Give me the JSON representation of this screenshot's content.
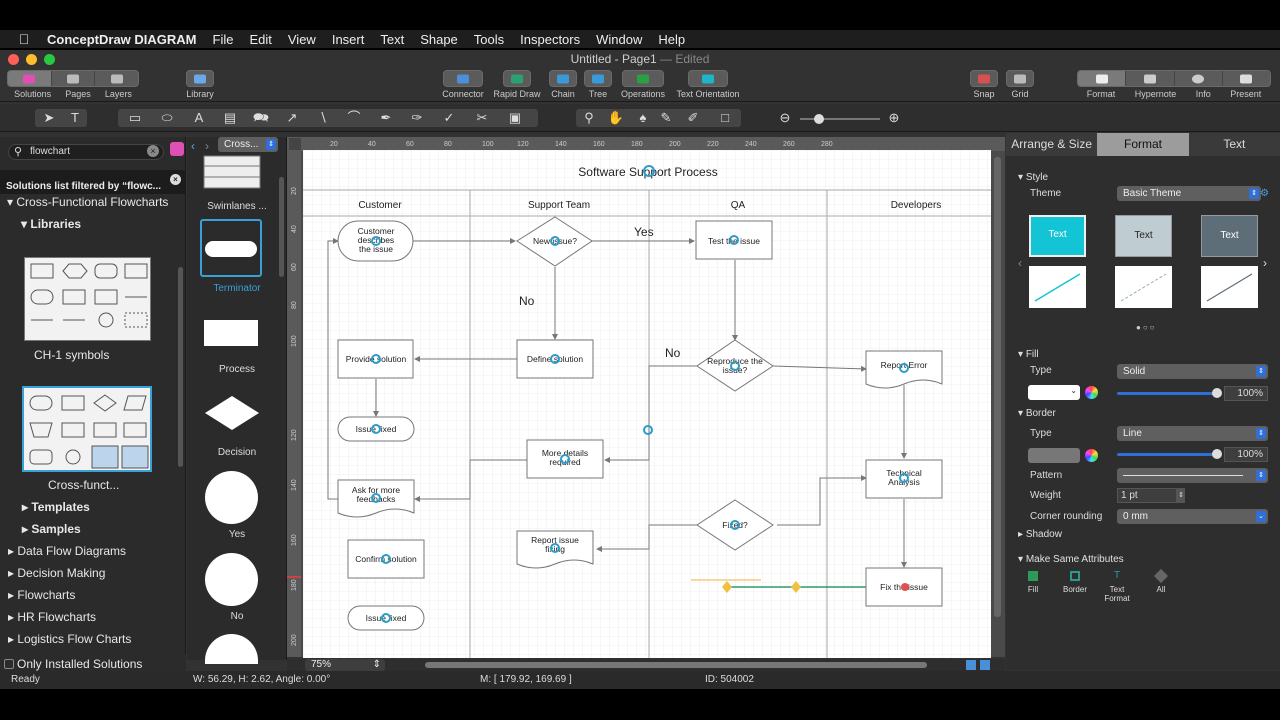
{
  "menubar": {
    "app_name": "ConceptDraw DIAGRAM",
    "items": [
      "File",
      "Edit",
      "View",
      "Insert",
      "Text",
      "Shape",
      "Tools",
      "Inspectors",
      "Window",
      "Help"
    ]
  },
  "window": {
    "title": "Untitled - Page1",
    "title_suffix": "— Edited"
  },
  "toolbar": {
    "solutions": "Solutions",
    "pages": "Pages",
    "layers": "Layers",
    "library": "Library",
    "connector": "Connector",
    "rapid_draw": "Rapid Draw",
    "chain": "Chain",
    "tree": "Tree",
    "operations": "Operations",
    "text_orientation": "Text Orientation",
    "snap": "Snap",
    "grid": "Grid",
    "format": "Format",
    "hypernote": "Hypernote",
    "info": "Info",
    "present": "Present"
  },
  "left_panel": {
    "search_value": "flowchart",
    "filter_note": "Solutions list filtered by “flowc...",
    "solution": "Cross-Functional Flowcharts",
    "libraries_heading": "Libraries",
    "lib1": "CH-1 symbols",
    "lib2": "Cross-funct...",
    "templates": "Templates",
    "samples": "Samples",
    "other_solutions": [
      "Data Flow Diagrams",
      "Decision Making",
      "Flowcharts",
      "HR Flowcharts",
      "Logistics Flow Charts"
    ],
    "only_installed": "Only Installed Solutions"
  },
  "shape_panel": {
    "library_select": "Cross...",
    "shapes": [
      "Swimlanes ...",
      "Terminator",
      "Process",
      "Decision",
      "Yes",
      "No"
    ]
  },
  "diagram": {
    "title": "Software Support Process",
    "lanes": [
      "Customer",
      "Support Team",
      "QA",
      "Developers"
    ],
    "labels": {
      "customer_describes": "Customer describes the issue",
      "new_issue": "New issue?",
      "test_issue": "Test the issue",
      "yes": "Yes",
      "no1": "No",
      "no2": "No",
      "provide_solution": "Provide solution",
      "define_solution": "Define solution",
      "reproduce": "Reproduce the issue?",
      "report_error": "Report Error",
      "issue_fixed1": "Issue fixed",
      "more_details": "More details required",
      "technical_analysis": "Technical Analysis",
      "ask_more": "Ask for more feedbacks",
      "fixed_q": "Fixed?",
      "report_issue_fixing": "Report issue fixing",
      "confirm_solution": "Confirm solution",
      "fix_issue": "Fix the issue",
      "issue_fixed2": "Issue fixed"
    },
    "ruler_ticks": [
      "20",
      "40",
      "60",
      "80",
      "100",
      "120",
      "140",
      "160",
      "180",
      "200",
      "220",
      "240",
      "260",
      "280"
    ],
    "ruler_ticks_v": [
      "20",
      "40",
      "60",
      "80",
      "100",
      "120",
      "140",
      "160",
      "180",
      "200"
    ]
  },
  "canvas_footer": {
    "zoom": "75%"
  },
  "right_panel": {
    "tabs": [
      "Arrange & Size",
      "Format",
      "Text"
    ],
    "style_heading": "Style",
    "theme_label": "Theme",
    "theme_value": "Basic Theme",
    "style_swatch_text": "Text",
    "fill_heading": "Fill",
    "fill_type_label": "Type",
    "fill_type_value": "Solid",
    "fill_opacity": "100%",
    "border_heading": "Border",
    "border_type_label": "Type",
    "border_type_value": "Line",
    "border_opacity": "100%",
    "pattern_label": "Pattern",
    "weight_label": "Weight",
    "weight_value": "1 pt",
    "corner_label": "Corner rounding",
    "corner_value": "0 mm",
    "shadow_heading": "Shadow",
    "make_same_heading": "Make Same Attributes",
    "make_same": [
      "Fill",
      "Border",
      "Text Format",
      "All"
    ]
  },
  "statusbar": {
    "ready": "Ready",
    "dims": "W: 56.29,  H: 2.62,  Angle: 0.00°",
    "mouse": "M: [ 179.92, 169.69 ]",
    "id": "ID: 504002"
  },
  "colors": {
    "accent_teal": "#1fc8d4",
    "selection_blue": "#2c9cc9",
    "brand_pink": "#e04fb3"
  }
}
